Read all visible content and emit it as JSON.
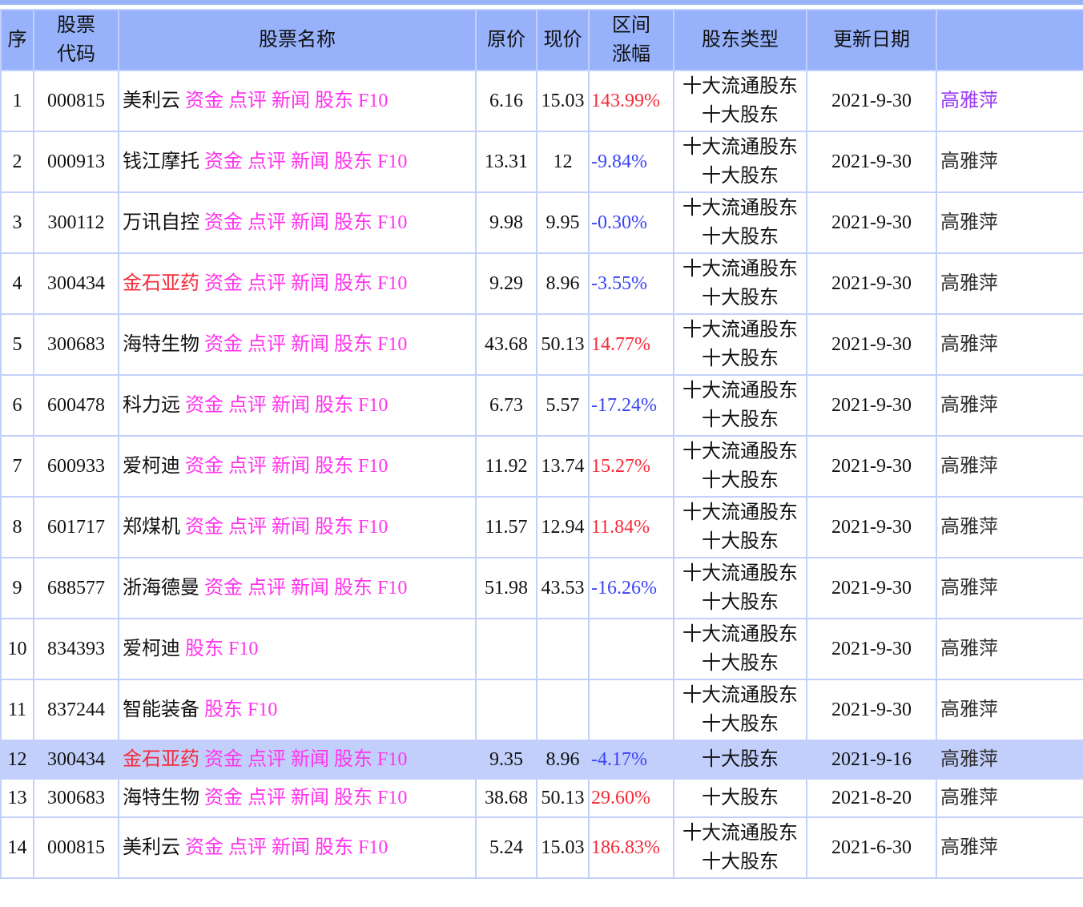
{
  "header": [
    "序",
    "股票\n代码",
    "股票名称",
    "原价",
    "现价",
    "区间\n涨幅",
    "股东类型",
    "更新日期",
    ""
  ],
  "link_labels": {
    "zijin": "资金",
    "dianping": "点评",
    "xinwen": "新闻",
    "gudong": "股东",
    "f10": "F10"
  },
  "colors": {
    "header_bg": "#97b2fa",
    "border": "#c3d0fb",
    "link": "#ff33ee",
    "up": "#f52a3a",
    "down": "#3a44f5",
    "highlight": "#c2cffb"
  },
  "rows": [
    {
      "no": "1",
      "code": "000815",
      "name": "美利云",
      "links": "full",
      "orig": "6.16",
      "cur": "15.03",
      "chg": "143.99%",
      "dir": "up",
      "type": [
        "十大流通股东",
        "十大股东"
      ],
      "date": "2021-9-30",
      "mgr": "高雅萍",
      "mgr_visited": true
    },
    {
      "no": "2",
      "code": "000913",
      "name": "钱江摩托",
      "links": "full",
      "orig": "13.31",
      "cur": "12",
      "chg": "-9.84%",
      "dir": "down",
      "type": [
        "十大流通股东",
        "十大股东"
      ],
      "date": "2021-9-30",
      "mgr": "高雅萍"
    },
    {
      "no": "3",
      "code": "300112",
      "name": "万讯自控",
      "links": "full",
      "orig": "9.98",
      "cur": "9.95",
      "chg": "-0.30%",
      "dir": "down",
      "type": [
        "十大流通股东",
        "十大股东"
      ],
      "date": "2021-9-30",
      "mgr": "高雅萍"
    },
    {
      "no": "4",
      "code": "300434",
      "name": "金石亚药",
      "name_red": true,
      "links": "full",
      "orig": "9.29",
      "cur": "8.96",
      "chg": "-3.55%",
      "dir": "down",
      "type": [
        "十大流通股东",
        "十大股东"
      ],
      "date": "2021-9-30",
      "mgr": "高雅萍"
    },
    {
      "no": "5",
      "code": "300683",
      "name": "海特生物",
      "links": "full",
      "orig": "43.68",
      "cur": "50.13",
      "chg": "14.77%",
      "dir": "up",
      "type": [
        "十大流通股东",
        "十大股东"
      ],
      "date": "2021-9-30",
      "mgr": "高雅萍"
    },
    {
      "no": "6",
      "code": "600478",
      "name": "科力远",
      "links": "full",
      "orig": "6.73",
      "cur": "5.57",
      "chg": "-17.24%",
      "dir": "down",
      "type": [
        "十大流通股东",
        "十大股东"
      ],
      "date": "2021-9-30",
      "mgr": "高雅萍"
    },
    {
      "no": "7",
      "code": "600933",
      "name": "爱柯迪",
      "links": "full",
      "orig": "11.92",
      "cur": "13.74",
      "chg": "15.27%",
      "dir": "up",
      "type": [
        "十大流通股东",
        "十大股东"
      ],
      "date": "2021-9-30",
      "mgr": "高雅萍"
    },
    {
      "no": "8",
      "code": "601717",
      "name": "郑煤机",
      "links": "full",
      "orig": "11.57",
      "cur": "12.94",
      "chg": "11.84%",
      "dir": "up",
      "type": [
        "十大流通股东",
        "十大股东"
      ],
      "date": "2021-9-30",
      "mgr": "高雅萍"
    },
    {
      "no": "9",
      "code": "688577",
      "name": "浙海德曼",
      "links": "full",
      "orig": "51.98",
      "cur": "43.53",
      "chg": "-16.26%",
      "dir": "down",
      "type": [
        "十大流通股东",
        "十大股东"
      ],
      "date": "2021-9-30",
      "mgr": "高雅萍"
    },
    {
      "no": "10",
      "code": "834393",
      "name": "爱柯迪",
      "links": "short",
      "orig": "",
      "cur": "",
      "chg": "",
      "dir": "",
      "type": [
        "十大流通股东",
        "十大股东"
      ],
      "date": "2021-9-30",
      "mgr": "高雅萍"
    },
    {
      "no": "11",
      "code": "837244",
      "name": "智能装备",
      "links": "short",
      "orig": "",
      "cur": "",
      "chg": "",
      "dir": "",
      "type": [
        "十大流通股东",
        "十大股东"
      ],
      "date": "2021-9-30",
      "mgr": "高雅萍"
    },
    {
      "no": "12",
      "code": "300434",
      "name": "金石亚药",
      "name_red": true,
      "links": "full",
      "orig": "9.35",
      "cur": "8.96",
      "chg": "-4.17%",
      "dir": "down",
      "type": [
        "十大股东"
      ],
      "date": "2021-9-16",
      "mgr": "高雅萍",
      "highlight": true
    },
    {
      "no": "13",
      "code": "300683",
      "name": "海特生物",
      "links": "full",
      "orig": "38.68",
      "cur": "50.13",
      "chg": "29.60%",
      "dir": "up",
      "type": [
        "十大股东"
      ],
      "date": "2021-8-20",
      "mgr": "高雅萍"
    },
    {
      "no": "14",
      "code": "000815",
      "name": "美利云",
      "links": "full",
      "orig": "5.24",
      "cur": "15.03",
      "chg": "186.83%",
      "dir": "up",
      "type": [
        "十大流通股东",
        "十大股东"
      ],
      "date": "2021-6-30",
      "mgr": "高雅萍"
    }
  ]
}
